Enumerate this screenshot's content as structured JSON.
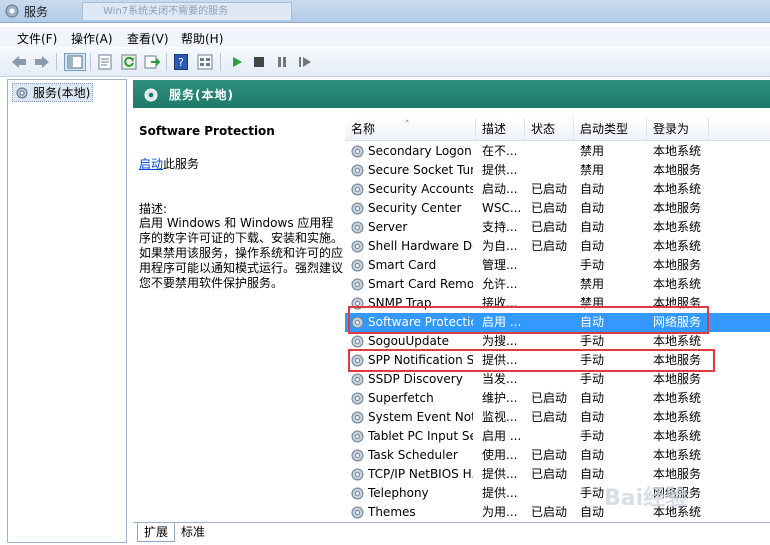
{
  "window": {
    "title": "服务",
    "background_tab": "Win7系统关闭不需要的服务"
  },
  "menu": [
    {
      "label": "文件(F)"
    },
    {
      "label": "操作(A)"
    },
    {
      "label": "查看(V)"
    },
    {
      "label": "帮助(H)"
    }
  ],
  "toolbar": [
    "back-arrow-icon",
    "forward-arrow-icon",
    "console-tree-icon",
    "properties-icon",
    "refresh-icon",
    "export-list-icon",
    "help-icon",
    "view-icon",
    "play-icon",
    "stop-icon",
    "pause-icon",
    "restart-icon"
  ],
  "tree": {
    "root_label": "服务(本地)"
  },
  "panel": {
    "header_title": "服务(本地)"
  },
  "detail": {
    "service_name": "Software Protection",
    "start_link": "启动",
    "start_suffix": "此服务",
    "desc_label": "描述:",
    "desc_text": "启用 Windows 和 Windows 应用程序的数字许可证的下载、安装和实施。如果禁用该服务，操作系统和许可的应用程序可能以通知模式运行。强烈建议您不要禁用软件保护服务。"
  },
  "list": {
    "columns": {
      "name": "名称",
      "desc": "描述",
      "status": "状态",
      "startup": "启动类型",
      "logon": "登录为"
    },
    "rows": [
      {
        "name": "Secondary Logon",
        "desc": "在不...",
        "status": "",
        "startup": "禁用",
        "logon": "本地系统"
      },
      {
        "name": "Secure Socket Tun...",
        "desc": "提供...",
        "status": "",
        "startup": "禁用",
        "logon": "本地服务"
      },
      {
        "name": "Security Accounts...",
        "desc": "启动...",
        "status": "已启动",
        "startup": "自动",
        "logon": "本地系统"
      },
      {
        "name": "Security Center",
        "desc": "WSC...",
        "status": "已启动",
        "startup": "自动",
        "logon": "本地服务"
      },
      {
        "name": "Server",
        "desc": "支持...",
        "status": "已启动",
        "startup": "自动",
        "logon": "本地系统"
      },
      {
        "name": "Shell Hardware De...",
        "desc": "为自...",
        "status": "已启动",
        "startup": "自动",
        "logon": "本地系统"
      },
      {
        "name": "Smart Card",
        "desc": "管理...",
        "status": "",
        "startup": "手动",
        "logon": "本地服务"
      },
      {
        "name": "Smart Card Remo...",
        "desc": "允许...",
        "status": "",
        "startup": "禁用",
        "logon": "本地系统"
      },
      {
        "name": "SNMP Trap",
        "desc": "接收...",
        "status": "",
        "startup": "禁用",
        "logon": "本地服务"
      },
      {
        "name": "Software Protection",
        "desc": "启用 ...",
        "status": "",
        "startup": "自动",
        "logon": "网络服务"
      },
      {
        "name": "SogouUpdate",
        "desc": "为搜...",
        "status": "",
        "startup": "手动",
        "logon": "本地系统"
      },
      {
        "name": "SPP Notification S...",
        "desc": "提供...",
        "status": "",
        "startup": "手动",
        "logon": "本地服务"
      },
      {
        "name": "SSDP Discovery",
        "desc": "当发...",
        "status": "",
        "startup": "手动",
        "logon": "本地服务"
      },
      {
        "name": "Superfetch",
        "desc": "维护...",
        "status": "已启动",
        "startup": "自动",
        "logon": "本地系统"
      },
      {
        "name": "System Event Noti...",
        "desc": "监视...",
        "status": "已启动",
        "startup": "自动",
        "logon": "本地系统"
      },
      {
        "name": "Tablet PC Input Se...",
        "desc": "启用 ...",
        "status": "",
        "startup": "手动",
        "logon": "本地系统"
      },
      {
        "name": "Task Scheduler",
        "desc": "使用...",
        "status": "已启动",
        "startup": "自动",
        "logon": "本地系统"
      },
      {
        "name": "TCP/IP NetBIOS H...",
        "desc": "提供...",
        "status": "已启动",
        "startup": "自动",
        "logon": "本地服务"
      },
      {
        "name": "Telephony",
        "desc": "提供...",
        "status": "",
        "startup": "手动",
        "logon": "网络服务"
      },
      {
        "name": "Themes",
        "desc": "为用...",
        "status": "已启动",
        "startup": "自动",
        "logon": "本地系统"
      }
    ]
  },
  "tabs": [
    {
      "label": "扩展"
    },
    {
      "label": "标准"
    }
  ],
  "watermark": "Bai经验",
  "colors": {
    "header": "#1e7a6b",
    "selection": "#3399ff",
    "highlight_box": "#e0393f",
    "link": "#0046d5"
  }
}
